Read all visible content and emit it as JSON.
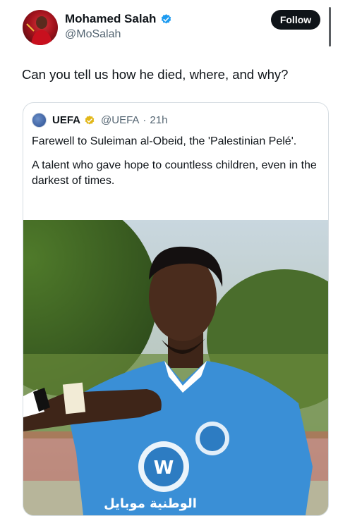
{
  "tweet": {
    "author_name": "Mohamed Salah",
    "author_handle": "@MoSalah",
    "follow_label": "Follow",
    "text": "Can you tell us how he died, where, and why?"
  },
  "quoted": {
    "author_name": "UEFA",
    "author_handle": "@UEFA",
    "separator": "·",
    "time": "21h",
    "paragraph1": "Farewell to Suleiman al-Obeid, the 'Palestinian Pelé'.",
    "paragraph2": "A talent who gave hope to countless children, even in the darkest of times.",
    "jersey_sponsor_text": "الوطنية موبايل"
  },
  "colors": {
    "follow_bg": "#0f1419",
    "verified_blue": "#1d9bf0",
    "verified_gold": "#e2b719",
    "secondary_text": "#536471",
    "jersey_blue": "#3a8fd6"
  }
}
